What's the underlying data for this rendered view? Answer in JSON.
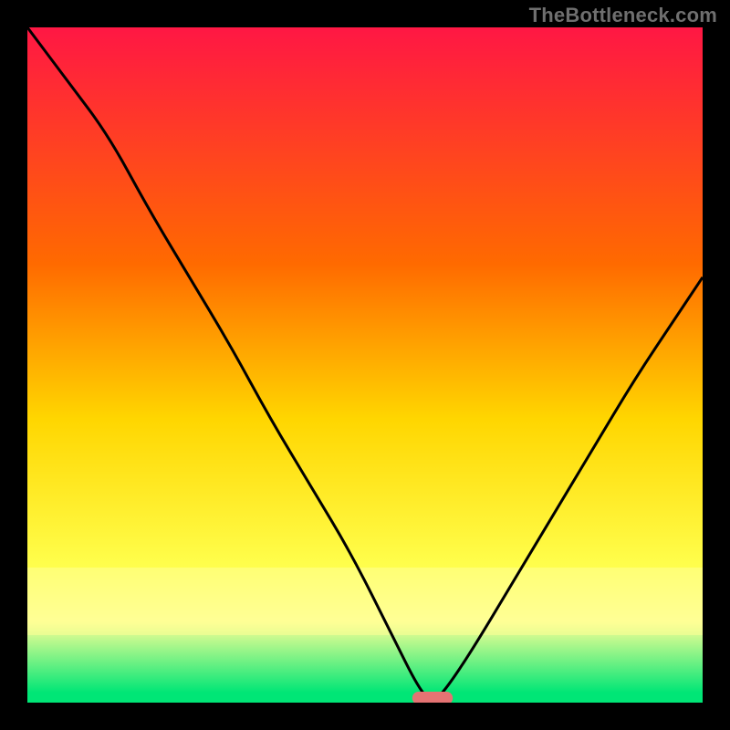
{
  "watermark": "TheBottleneck.com",
  "colors": {
    "top": "#ff1744",
    "mid1": "#ff6a00",
    "mid2": "#ffd600",
    "mid3": "#ffff4d",
    "band_pale": "#ffff96",
    "green": "#00e676",
    "marker": "#e57373",
    "curve": "#000000",
    "frame_bg": "#000000"
  },
  "chart_data": {
    "type": "line",
    "title": "",
    "xlabel": "",
    "ylabel": "",
    "xlim": [
      0,
      100
    ],
    "ylim": [
      0,
      100
    ],
    "series": [
      {
        "name": "bottleneck-curve",
        "x": [
          0,
          6,
          12,
          18,
          24,
          30,
          36,
          42,
          48,
          54,
          58,
          60,
          62,
          66,
          72,
          78,
          84,
          90,
          96,
          100
        ],
        "y": [
          100,
          92,
          84,
          73,
          63,
          53,
          42,
          32,
          22,
          10,
          2,
          0,
          2,
          8,
          18,
          28,
          38,
          48,
          57,
          63
        ]
      }
    ],
    "marker": {
      "x_start": 57,
      "x_end": 63,
      "y": 0
    },
    "gradient_stops": [
      {
        "pos": 0.0,
        "color": "#ff1744"
      },
      {
        "pos": 0.35,
        "color": "#ff6a00"
      },
      {
        "pos": 0.58,
        "color": "#ffd600"
      },
      {
        "pos": 0.8,
        "color": "#ffff4d"
      },
      {
        "pos": 0.88,
        "color": "#ffff96"
      },
      {
        "pos": 0.985,
        "color": "#00e676"
      },
      {
        "pos": 1.0,
        "color": "#00e676"
      }
    ]
  }
}
